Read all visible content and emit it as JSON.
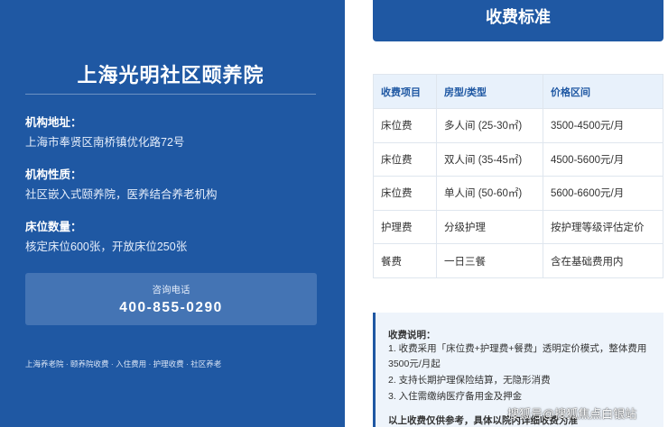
{
  "institution": {
    "name": "上海光明社区颐养院",
    "address_label": "机构地址：",
    "address_value": "上海市奉贤区南桥镇优化路72号",
    "nature_label": "机构性质：",
    "nature_value": "社区嵌入式颐养院，医养结合养老机构",
    "beds_label": "床位数量：",
    "beds_value": "核定床位600张，开放床位250张"
  },
  "contact": {
    "label": "咨询电话",
    "phone": "400-855-0290"
  },
  "footer_tags": "上海养老院 · 颐养院收费 · 入住费用 · 护理收费 · 社区养老",
  "fees": {
    "header": "收费标准",
    "columns": [
      "收费项目",
      "房型/类型",
      "价格区间"
    ],
    "rows": [
      [
        "床位费",
        "多人间 (25-30㎡)",
        "3500-4500元/月"
      ],
      [
        "床位费",
        "双人间 (35-45㎡)",
        "4500-5600元/月"
      ],
      [
        "床位费",
        "单人间 (50-60㎡)",
        "5600-6600元/月"
      ],
      [
        "护理费",
        "分级护理",
        "按护理等级评估定价"
      ],
      [
        "餐费",
        "一日三餐",
        "含在基础费用内"
      ]
    ]
  },
  "notes": {
    "title": "收费说明：",
    "lines": [
      "1. 收费采用「床位费+护理费+餐费」透明定价模式，整体费用3500元/月起",
      "2. 支持长期护理保险结算，无隐形消费",
      "3. 入住需缴纳医疗备用金及押金"
    ],
    "footer": "以上收费仅供参考，具体以院内详细收费为准"
  },
  "watermark": "搜狐号@搜狐焦点白银站"
}
